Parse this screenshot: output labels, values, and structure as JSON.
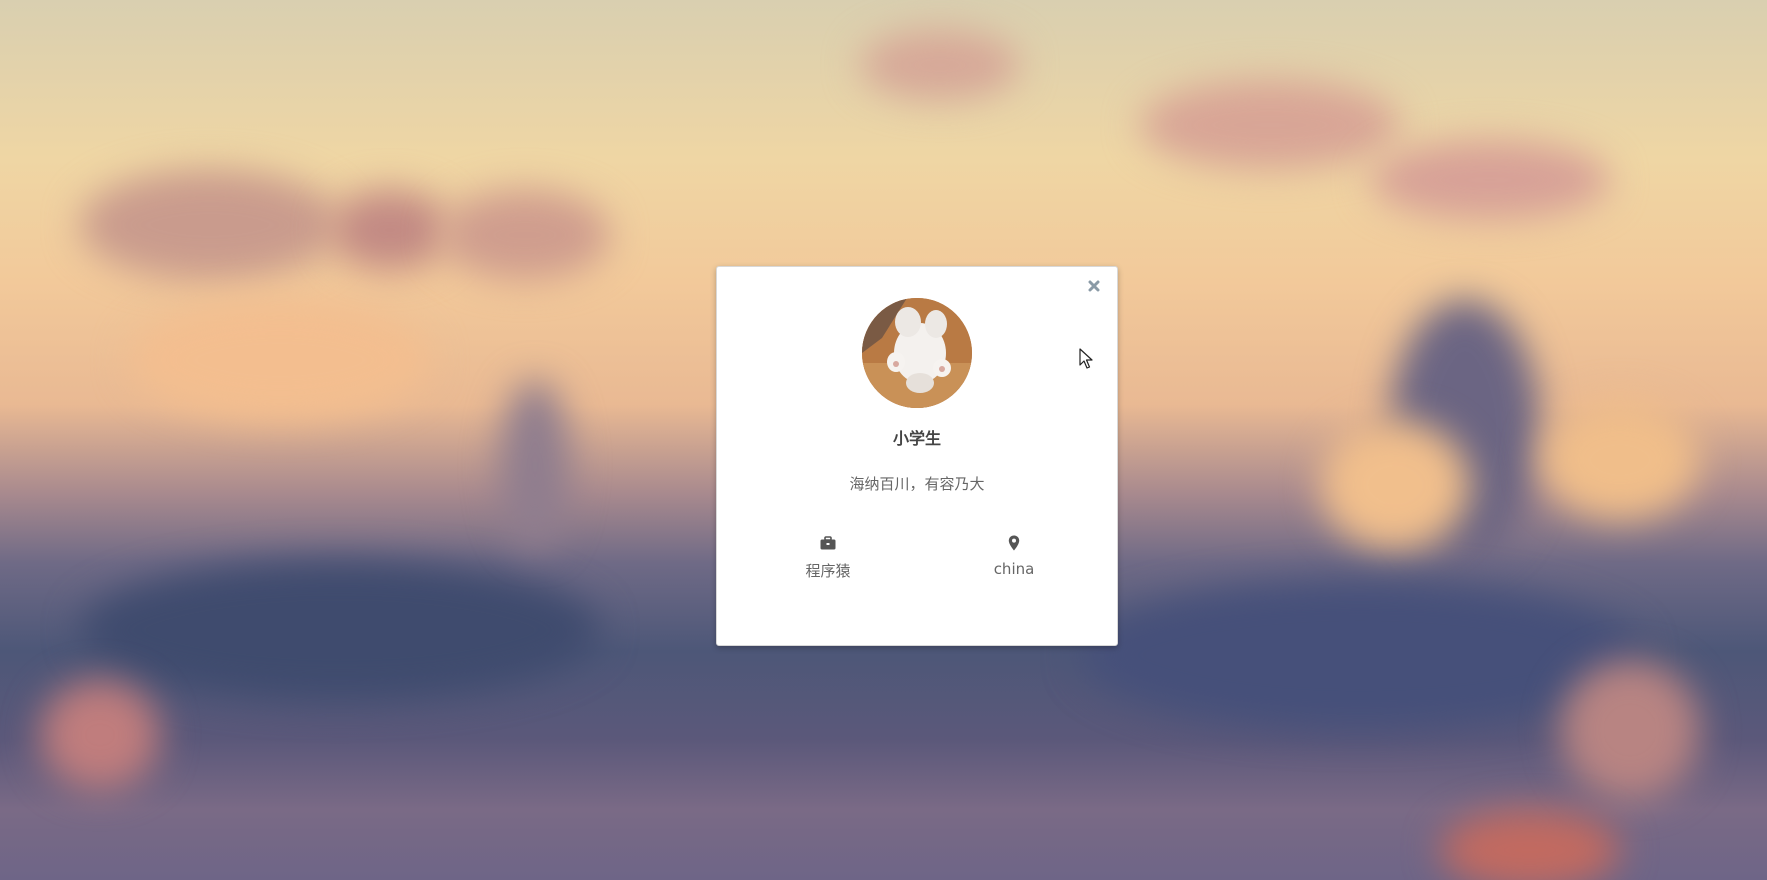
{
  "profile": {
    "name": "小学生",
    "motto": "海纳百川，有容乃大",
    "job": "程序猿",
    "location": "china"
  },
  "icons": {
    "close": "close-icon",
    "job": "briefcase-icon",
    "location": "map-marker-icon"
  },
  "colors": {
    "card_bg": "#ffffff",
    "text_primary": "#444444",
    "text_secondary": "#666666",
    "icon": "#555555",
    "close_icon": "#8a9aa6"
  }
}
